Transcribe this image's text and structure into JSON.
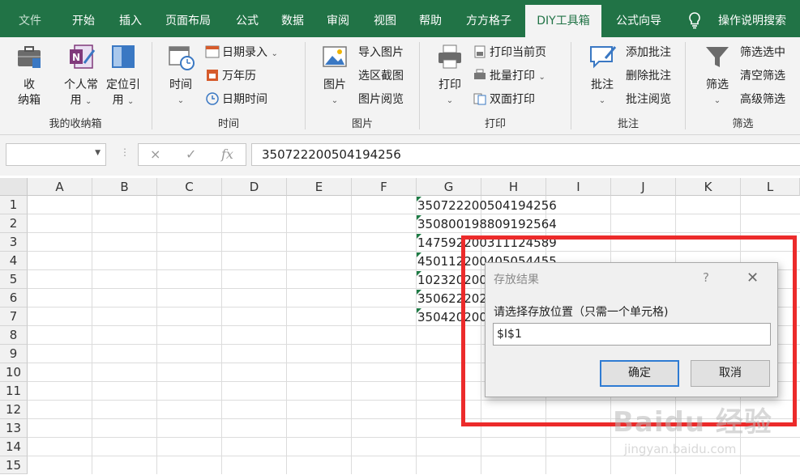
{
  "ribbon_tabs": [
    {
      "label": "文件"
    },
    {
      "label": "开始"
    },
    {
      "label": "插入"
    },
    {
      "label": "页面布局"
    },
    {
      "label": "公式"
    },
    {
      "label": "数据"
    },
    {
      "label": "审阅"
    },
    {
      "label": "视图"
    },
    {
      "label": "帮助"
    },
    {
      "label": "方方格子"
    },
    {
      "label": "DIY工具箱"
    },
    {
      "label": "公式向导"
    }
  ],
  "active_tab": "DIY工具箱",
  "search_label": "操作说明搜索",
  "groups": {
    "my_box": {
      "label": "我的收纳箱",
      "shoubox": {
        "line1": "收",
        "line2": "纳箱"
      },
      "personal": {
        "line1": "个人常",
        "line2": "用"
      },
      "locate": {
        "line1": "定位引",
        "line2": "用"
      }
    },
    "time": {
      "label": "时间",
      "time_btn": "时间",
      "date_entry": "日期录入",
      "calendar": "万年历",
      "datetime": "日期时间"
    },
    "picture": {
      "label": "图片",
      "picture_btn": "图片",
      "import_pic": "导入图片",
      "select_capture": "选区截图",
      "pic_browse": "图片阅览"
    },
    "print": {
      "label": "打印",
      "print_btn": "打印",
      "print_current": "打印当前页",
      "batch_print": "批量打印",
      "duplex_print": "双面打印"
    },
    "comment": {
      "label": "批注",
      "comment_btn": "批注",
      "add_comment": "添加批注",
      "delete_comment": "删除批注",
      "browse_comment": "批注阅览"
    },
    "filter": {
      "label": "筛选",
      "filter_btn": "筛选",
      "filter_selected": "筛选选中",
      "clear_filter": "清空筛选",
      "advanced_filter": "高级筛选"
    }
  },
  "formula_bar": {
    "name_box": "",
    "cancel_icon": "×",
    "enter_icon": "✓",
    "fx_icon": "fx",
    "value": "350722200504194256"
  },
  "columns": [
    "A",
    "B",
    "C",
    "D",
    "E",
    "F",
    "G",
    "H",
    "I",
    "J",
    "K",
    "L"
  ],
  "rows": [
    "1",
    "2",
    "3",
    "4",
    "5",
    "6",
    "7",
    "8",
    "9",
    "10",
    "11",
    "12",
    "13",
    "14",
    "15"
  ],
  "g_column_values": [
    "350722200504194256",
    "350800198809192564",
    "147592200311124589",
    "450112200405054455",
    "102320200",
    "350622202",
    "350420200"
  ],
  "dialog": {
    "title": "存放结果",
    "help": "?",
    "close": "✕",
    "prompt": "请选择存放位置（只需一个单元格)",
    "input_value": "$I$1",
    "ok": "确定",
    "cancel": "取消"
  },
  "watermark": {
    "main": "Baidu 经验",
    "sub": "jingyan.baidu.com"
  },
  "colors": {
    "ribbon_green": "#217346",
    "highlight_red": "#ec2b2b",
    "dialog_focus": "#2e7bd3"
  }
}
